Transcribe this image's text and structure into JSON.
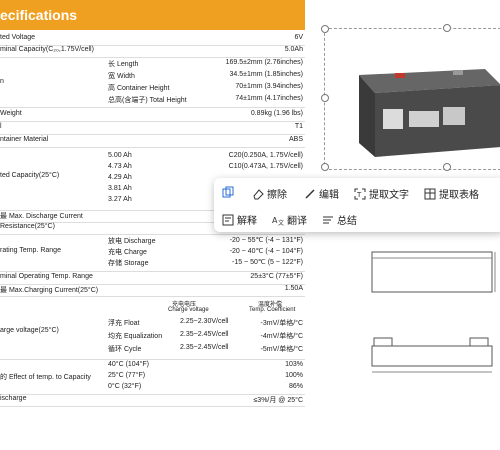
{
  "header": {
    "title": "ecifications"
  },
  "specs": {
    "rated_voltage": {
      "label": "ted Voltage",
      "value": "6V"
    },
    "nominal_capacity": {
      "label": "minal Capacity(C₂₀,1.75V/cell)",
      "value": "5.0Ah"
    },
    "dimension": {
      "label": "n",
      "rows": [
        {
          "name": "长 Length",
          "value": "169.5±2mm (2.76inches)"
        },
        {
          "name": "宽 Width",
          "value": "34.5±1mm (1.85inches)"
        },
        {
          "name": "高 Container Height",
          "value": "70±1mm (3.94inches)"
        },
        {
          "name": "总高(含端子) Total Height",
          "value": "74±1mm (4.17inches)"
        }
      ]
    },
    "weight": {
      "label": "Weight",
      "value": "0.89kg (1.96 lbs)"
    },
    "terminal": {
      "label": "l",
      "value": "T1"
    },
    "container_material": {
      "label": "ntainer Material",
      "value": "ABS"
    },
    "rated_capacity": {
      "label": "ted Capacity(25°C)",
      "rows": [
        {
          "left": "5.00 Ah",
          "right": "C20(0.250A, 1.75V/cell)"
        },
        {
          "left": "4.73 Ah",
          "right": "C10(0.473A, 1.75V/cell)"
        },
        {
          "left": "4.29 Ah",
          "right": ""
        },
        {
          "left": "3.81 Ah",
          "right": ""
        },
        {
          "left": "3.27 Ah",
          "right": ""
        }
      ]
    },
    "max_discharge": {
      "label": "最 Max. Discharge Current"
    },
    "internal_resistance": {
      "label": "Resistance(25°C)"
    },
    "operating_range": {
      "label": "rating Temp. Range",
      "rows": [
        {
          "name": "放电 Discharge",
          "value": "-20 ~ 55℃ (-4 ~ 131°F)"
        },
        {
          "name": "充电 Charge",
          "value": "-20 ~ 40℃ (-4 ~ 104°F)"
        },
        {
          "name": "存储 Storage",
          "value": "-15 ~ 50℃ (5 ~ 122°F)"
        }
      ]
    },
    "nominal_temp_range": {
      "label": "minal Operating Temp. Range",
      "value": "25±3°C (77±5°F)"
    },
    "max_charging": {
      "label": "最 Max.Charging Current(25°C)",
      "value": "1.50A"
    },
    "charge_voltage": {
      "label": "arge voltage(25°C)",
      "col1_cn": "充电电压",
      "col1_en": "Charge voltage",
      "col2_cn": "温度补偿",
      "col2_en": "Temp. Coefficient",
      "rows": [
        {
          "name": "浮充 Float",
          "v": "2.25~2.30V/cell",
          "c": "-3mV/单格/°C"
        },
        {
          "name": "均充 Equalization",
          "v": "2.35~2.45V/cell",
          "c": "-4mV/单格/°C"
        },
        {
          "name": "循环 Cycle",
          "v": "2.35~2.45V/cell",
          "c": "-5mV/单格/°C"
        }
      ]
    },
    "temp_effect": {
      "label": "的 Effect of temp. to Capacity",
      "rows": [
        {
          "name": "40°C (104°F)",
          "value": "103%"
        },
        {
          "name": "25°C (77°F)",
          "value": "100%"
        },
        {
          "name": "0°C (32°F)",
          "value": "86%"
        }
      ]
    },
    "self_discharge": {
      "label": "ischarge",
      "value": "≤3%/月 @ 25°C"
    }
  },
  "toolbar": {
    "erase": "擦除",
    "edit": "编辑",
    "extract_text": "提取文字",
    "extract_table": "提取表格",
    "explain": "解释",
    "translate": "翻译",
    "summary": "总结"
  },
  "colors": {
    "accent": "#f0a020"
  }
}
